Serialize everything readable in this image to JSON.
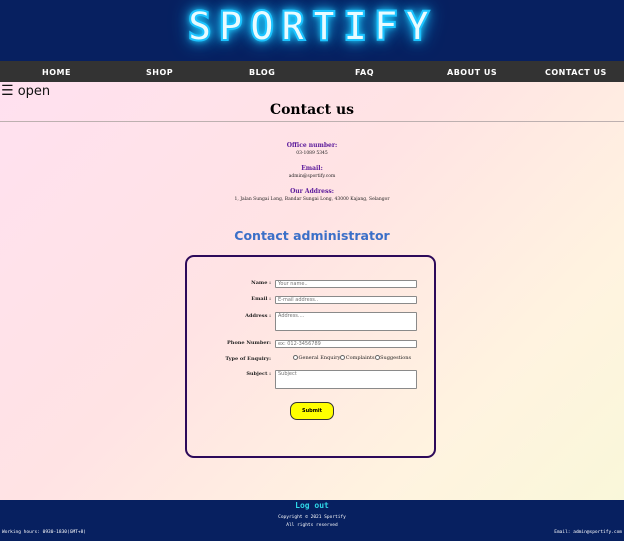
{
  "header": {
    "logo": "SPORTIFY"
  },
  "nav": {
    "items": [
      {
        "label": "HOME"
      },
      {
        "label": "SHOP"
      },
      {
        "label": "BLOG"
      },
      {
        "label": "FAQ"
      },
      {
        "label": "ABOUT US"
      },
      {
        "label": "CONTACT US"
      }
    ]
  },
  "sidenav": {
    "toggle_icon": "☰",
    "toggle_label": "open"
  },
  "page": {
    "title": "Contact us"
  },
  "contact": {
    "office_label": "Office number:",
    "office_value": "03-1089 5345",
    "email_label": "Email:",
    "email_value": "admin@sportify.com",
    "address_label": "Our Address:",
    "address_value": "1, Jalan Sungai Long, Bandar Sungai Long, 43000 Kajang, Selangor"
  },
  "form": {
    "heading": "Contact administrator",
    "name_label": "Name :",
    "name_placeholder": "Your name..",
    "email_label": "Email :",
    "email_placeholder": "E-mail address..",
    "address_label": "Address :",
    "address_placeholder": "Address....",
    "phone_label": "Phone Number:",
    "phone_placeholder": "ex: 012-3456789",
    "enquiry_label": "Type of Enquiry:",
    "enquiry_options": [
      "General Enquiry",
      "Complaints",
      "Suggestions"
    ],
    "subject_label": "Subject :",
    "subject_placeholder": "Subject",
    "submit_label": "Submit"
  },
  "footer": {
    "logout": "Log out",
    "copyright": "Copyright © 2021 Sportify",
    "rights": "All rights reserved",
    "hours": "Working hours: 0930-1830(GMT+8)",
    "email": "Email: admin@sportify.com"
  }
}
